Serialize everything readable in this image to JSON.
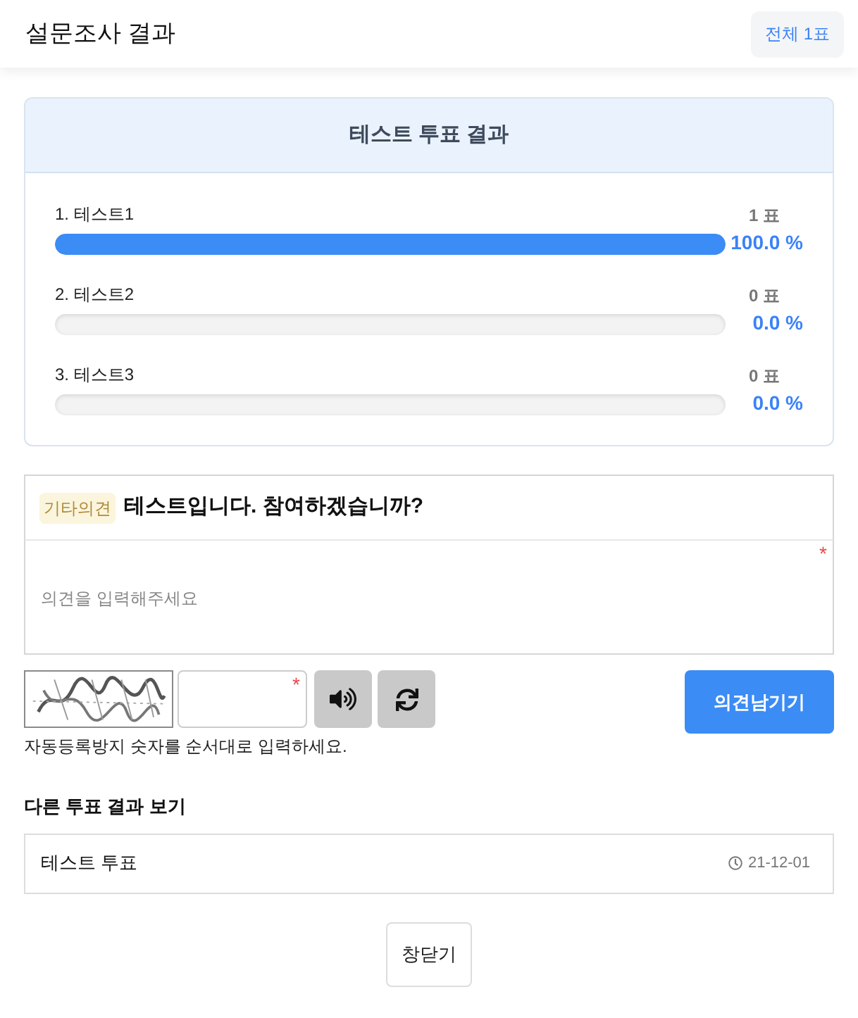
{
  "header": {
    "title": "설문조사 결과",
    "total_button": "전체 1표"
  },
  "poll": {
    "title": "테스트 투표 결과",
    "options": [
      {
        "label": "1. 테스트1",
        "votes": "1 표",
        "percent": "100.0 %",
        "level": 1
      },
      {
        "label": "2. 테스트2",
        "votes": "0 표",
        "percent": "0.0 %",
        "level": 0
      },
      {
        "label": "3. 테스트3",
        "votes": "0 표",
        "percent": "0.0 %",
        "level": 0
      }
    ]
  },
  "opinion": {
    "tag": "기타의견",
    "question": "테스트입니다. 참여하겠습니까?",
    "required_mark": "*",
    "placeholder": "의견을 입력해주세요"
  },
  "captcha": {
    "required_mark": "*",
    "hint": "자동등록방지 숫자를 순서대로 입력하세요."
  },
  "submit_button": "의견남기기",
  "other_polls": {
    "title": "다른 투표 결과 보기",
    "items": [
      {
        "title": "테스트 투표",
        "date": "21-12-01"
      }
    ]
  },
  "close_button": "창닫기"
}
